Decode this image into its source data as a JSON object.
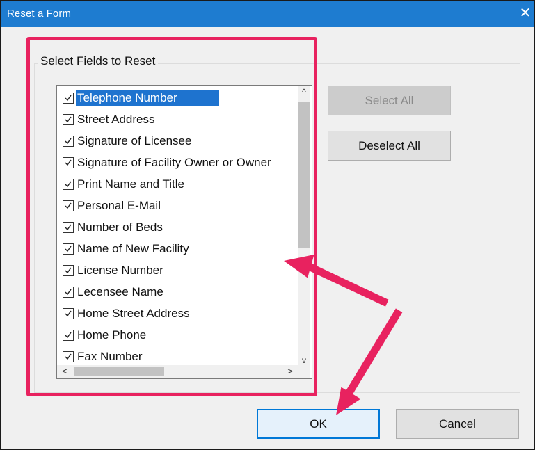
{
  "window": {
    "title": "Reset a Form",
    "close_glyph": "✕"
  },
  "group": {
    "legend": "Select Fields to Reset"
  },
  "fields": [
    {
      "label": "Telephone Number",
      "checked": true,
      "selected": true
    },
    {
      "label": "Street Address",
      "checked": true,
      "selected": false
    },
    {
      "label": "Signature of Licensee",
      "checked": true,
      "selected": false
    },
    {
      "label": "Signature of Facility Owner or Owner",
      "checked": true,
      "selected": false
    },
    {
      "label": "Print Name and Title",
      "checked": true,
      "selected": false
    },
    {
      "label": "Personal E-Mail",
      "checked": true,
      "selected": false
    },
    {
      "label": "Number of Beds",
      "checked": true,
      "selected": false
    },
    {
      "label": "Name of New Facility",
      "checked": true,
      "selected": false
    },
    {
      "label": "License Number",
      "checked": true,
      "selected": false
    },
    {
      "label": "Lecensee Name",
      "checked": true,
      "selected": false
    },
    {
      "label": "Home Street Address",
      "checked": true,
      "selected": false
    },
    {
      "label": "Home Phone",
      "checked": true,
      "selected": false
    },
    {
      "label": "Fax Number",
      "checked": true,
      "selected": false
    }
  ],
  "scroll": {
    "up_glyph": "^",
    "down_glyph": "v",
    "left_glyph": "<",
    "right_glyph": ">"
  },
  "buttons": {
    "select_all": "Select All",
    "deselect_all": "Deselect All",
    "ok": "OK",
    "cancel": "Cancel"
  },
  "colors": {
    "titlebar": "#1e7cd0",
    "selection": "#1e73cf",
    "annotation": "#e8225f"
  },
  "icons": {
    "checkbox": "checkmark-icon",
    "annotation": "arrow-annotation-icon"
  }
}
